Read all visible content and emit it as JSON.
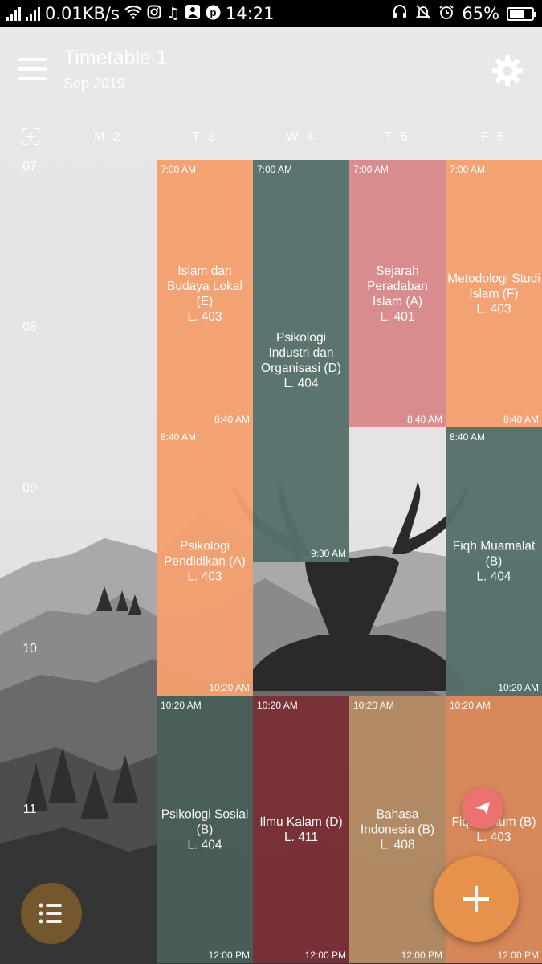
{
  "status_bar": {
    "speed": "0.01KB/s",
    "time": "14:21",
    "battery": "65%",
    "battery_level": 0.65
  },
  "toolbar": {
    "title": "Timetable 1",
    "subtitle": "Sep 2019"
  },
  "days": [
    "M 2",
    "T 3",
    "W 4",
    "T 5",
    "F 6"
  ],
  "hours": [
    "07",
    "08",
    "09",
    "10",
    "11"
  ],
  "events": [
    {
      "day": 1,
      "start": "7:00 AM",
      "end": "8:40 AM",
      "name": "Islam dan Budaya Lokal (E)",
      "room": "L. 403",
      "color": "#f4a070"
    },
    {
      "day": 2,
      "start": "7:00 AM",
      "end": "9:30 AM",
      "name": "Psikologi Industri dan Organisasi (D)",
      "room": "L. 404",
      "color": "#56706b"
    },
    {
      "day": 3,
      "start": "7:00 AM",
      "end": "8:40 AM",
      "name": "Sejarah Peradaban Islam (A)",
      "room": "L. 401",
      "color": "#d8898a"
    },
    {
      "day": 4,
      "start": "7:00 AM",
      "end": "8:40 AM",
      "name": "Metodologi Studi Islam (F)",
      "room": "L. 403",
      "color": "#f4a070"
    },
    {
      "day": 1,
      "start": "8:40 AM",
      "end": "10:20 AM",
      "name": "Psikologi Pendidikan (A)",
      "room": "L. 403",
      "color": "#f4a070"
    },
    {
      "day": 4,
      "start": "8:40 AM",
      "end": "10:20 AM",
      "name": "Fiqh Muamalat (B)",
      "room": "L. 404",
      "color": "#56706b"
    },
    {
      "day": 1,
      "start": "10:20 AM",
      "end": "12:00 PM",
      "name": "Psikologi Sosial (B)",
      "room": "L. 404",
      "color": "#4a5f5a"
    },
    {
      "day": 2,
      "start": "10:20 AM",
      "end": "12:00 PM",
      "name": "Ilmu Kalam (D)",
      "room": "L. 411",
      "color": "#7a3035"
    },
    {
      "day": 3,
      "start": "10:20 AM",
      "end": "12:00 PM",
      "name": "Bahasa Indonesia (B)",
      "room": "L. 408",
      "color": "#b58d66"
    },
    {
      "day": 4,
      "start": "10:20 AM",
      "end": "12:00 PM",
      "name": "Fiqh Umum (B)",
      "room": "L. 403",
      "color": "#dd8b5b"
    }
  ],
  "icons": {
    "menu": "hamburger-menu-icon",
    "settings": "gear-icon",
    "today": "focus-today-icon",
    "list": "list-icon",
    "add": "plus-icon",
    "navigate": "navigation-arrow-icon"
  }
}
